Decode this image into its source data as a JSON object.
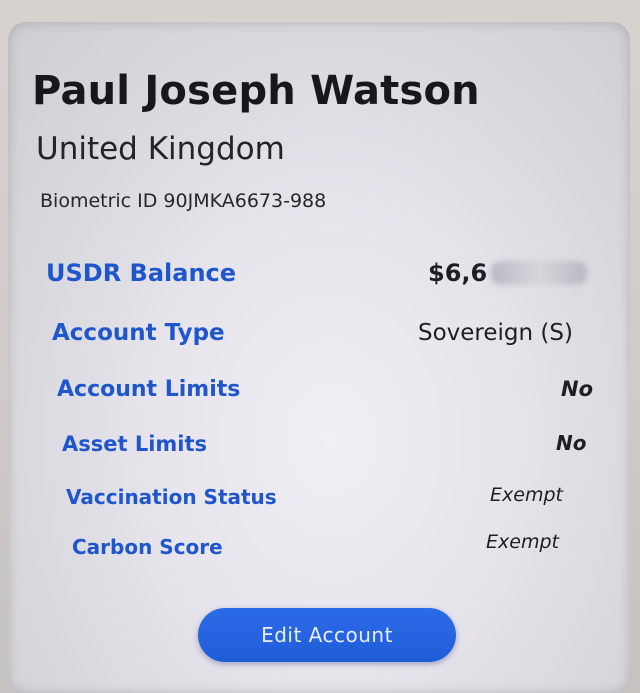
{
  "profile": {
    "name": "Paul Joseph Watson",
    "country": "United Kingdom",
    "biometric_id": "Biometric ID 90JMKA6673-988"
  },
  "account_rows": [
    {
      "label": "USDR Balance",
      "value": "$6,6"
    },
    {
      "label": "Account Type",
      "value": "Sovereign (S)"
    },
    {
      "label": "Account Limits",
      "value": "No"
    },
    {
      "label": "Asset Limits",
      "value": "No"
    },
    {
      "label": "Vaccination Status",
      "value": "Exempt"
    },
    {
      "label": "Carbon Score",
      "value": "Exempt"
    }
  ],
  "actions": {
    "edit_label": "Edit Account"
  },
  "colors": {
    "label_blue": "#1f56cc",
    "button_blue": "#2563e0"
  }
}
